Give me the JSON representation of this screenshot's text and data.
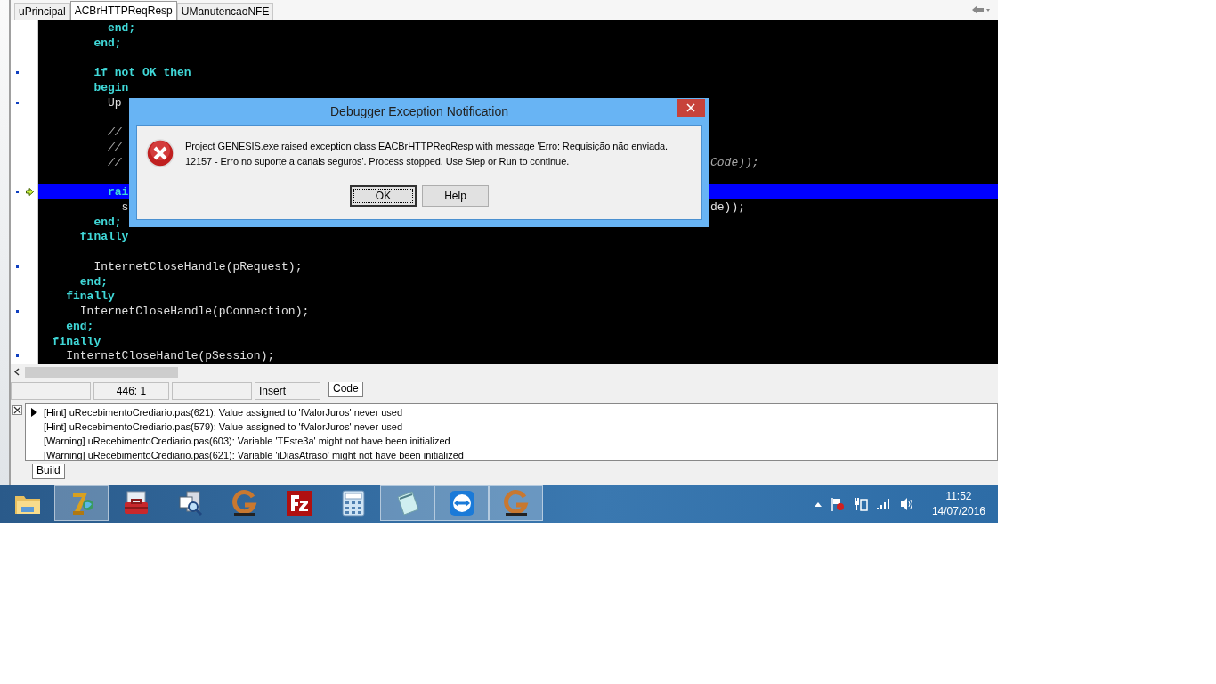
{
  "tabs": [
    {
      "label": "uPrincipal",
      "selected": false
    },
    {
      "label": "ACBrHTTPReqResp",
      "selected": true
    },
    {
      "label": "UManutencaoNFE",
      "selected": false
    }
  ],
  "editor": {
    "lines": [
      {
        "text": "          end;",
        "kind": "keyword"
      },
      {
        "text": "        end;",
        "kind": "keyword"
      },
      {
        "kind": "blank"
      },
      {
        "text": "        if not OK then",
        "kind": "keyword",
        "dot": true
      },
      {
        "text": "        begin",
        "kind": "keyword"
      },
      {
        "text": "          Up",
        "kind": "call",
        "dot": true
      },
      {
        "kind": "blank"
      },
      {
        "text": "          //",
        "kind": "comment"
      },
      {
        "text": "          //",
        "kind": "comment"
      },
      {
        "text": "          //",
        "kind": "comment",
        "tail": "Code));"
      },
      {
        "kind": "blank"
      },
      {
        "text": "          rai",
        "kind": "keyword",
        "dot": true,
        "current": true
      },
      {
        "text": "            s",
        "kind": "call",
        "tail": "de));"
      },
      {
        "text": "        end;",
        "kind": "keyword"
      },
      {
        "text": "      finally",
        "kind": "keyword"
      },
      {
        "kind": "blank"
      },
      {
        "text": "        InternetCloseHandle(pRequest);",
        "kind": "call",
        "dot": true
      },
      {
        "text": "      end;",
        "kind": "keyword"
      },
      {
        "text": "    finally",
        "kind": "keyword"
      },
      {
        "text": "      InternetCloseHandle(pConnection);",
        "kind": "call",
        "dot": true
      },
      {
        "text": "    end;",
        "kind": "keyword"
      },
      {
        "text": "  finally",
        "kind": "keyword"
      },
      {
        "text": "    InternetCloseHandle(pSession);",
        "kind": "call",
        "dot": true
      }
    ]
  },
  "status_bar": {
    "position": "446:  1",
    "mode": "Insert",
    "tab": "Code"
  },
  "messages": {
    "lines": [
      "[Hint] uRecebimentoCrediario.pas(621): Value assigned to 'fValorJuros' never used",
      "[Hint] uRecebimentoCrediario.pas(579): Value assigned to 'fValorJuros' never used",
      "[Warning] uRecebimentoCrediario.pas(603): Variable 'TEste3a' might not have been initialized",
      "[Warning] uRecebimentoCrediario.pas(621): Variable 'iDiasAtraso' might not have been initialized"
    ],
    "tab": "Build"
  },
  "dialog": {
    "title": "Debugger Exception Notification",
    "message": [
      "Project GENESIS.exe raised exception class EACBrHTTPReqResp with message 'Erro: Requisição não enviada.",
      "12157 - Erro no suporte a canais seguros'. Process stopped. Use Step or Run to continue."
    ],
    "buttons": [
      {
        "label": "OK",
        "default": true
      },
      {
        "label": "Help",
        "default": false
      }
    ]
  },
  "taskbar": {
    "apps": [
      {
        "kind": "folder",
        "running": false
      },
      {
        "kind": "seven",
        "running": true
      },
      {
        "kind": "toolbox",
        "running": false
      },
      {
        "kind": "inspect",
        "running": false
      },
      {
        "kind": "g-logo",
        "running": false
      },
      {
        "kind": "fz",
        "running": false
      },
      {
        "kind": "calculator",
        "running": false
      },
      {
        "kind": "notepad",
        "running": true
      },
      {
        "kind": "remote",
        "running": true
      },
      {
        "kind": "g-logo",
        "running": true
      }
    ],
    "time": "11:52",
    "date": "14/07/2016"
  }
}
